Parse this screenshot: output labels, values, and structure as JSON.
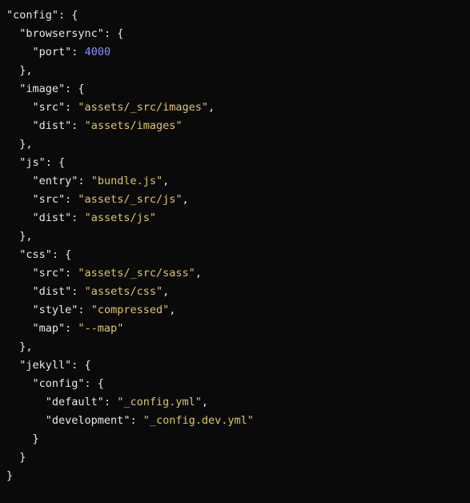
{
  "code": {
    "config_key": "\"config\"",
    "browsersync_key": "\"browsersync\"",
    "browsersync": {
      "port_key": "\"port\"",
      "port_val": "4000"
    },
    "image_key": "\"image\"",
    "image": {
      "src_key": "\"src\"",
      "src_val": "\"assets/_src/images\"",
      "dist_key": "\"dist\"",
      "dist_val": "\"assets/images\""
    },
    "js_key": "\"js\"",
    "js": {
      "entry_key": "\"entry\"",
      "entry_val": "\"bundle.js\"",
      "src_key": "\"src\"",
      "src_val": "\"assets/_src/js\"",
      "dist_key": "\"dist\"",
      "dist_val": "\"assets/js\""
    },
    "css_key": "\"css\"",
    "css": {
      "src_key": "\"src\"",
      "src_val": "\"assets/_src/sass\"",
      "dist_key": "\"dist\"",
      "dist_val": "\"assets/css\"",
      "style_key": "\"style\"",
      "style_val": "\"compressed\"",
      "map_key": "\"map\"",
      "map_val": "\"--map\""
    },
    "jekyll_key": "\"jekyll\"",
    "jekyll": {
      "config_key": "\"config\"",
      "default_key": "\"default\"",
      "default_val": "\"_config.yml\"",
      "development_key": "\"development\"",
      "development_val": "\"_config.dev.yml\""
    }
  }
}
